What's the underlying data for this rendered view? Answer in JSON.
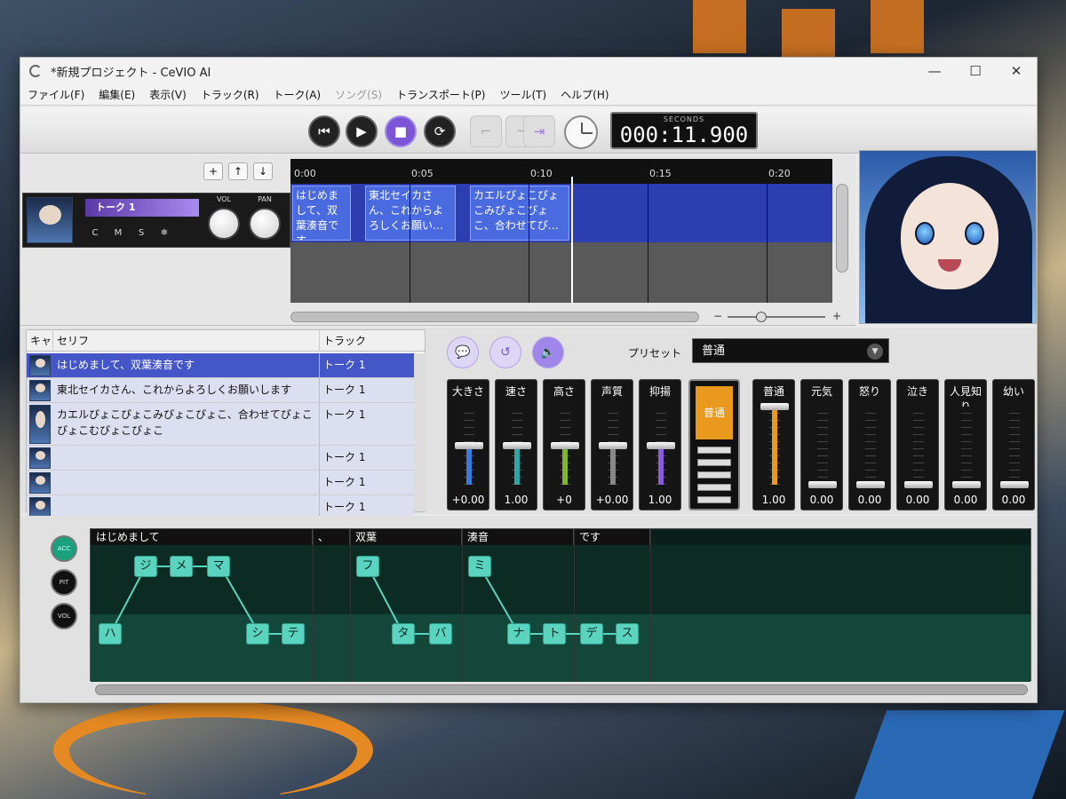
{
  "window": {
    "title": "*新規プロジェクト - CeVIO AI",
    "controls": [
      "—",
      "☐",
      "✕"
    ]
  },
  "menu": [
    {
      "label": "ファイル(F)",
      "enabled": true
    },
    {
      "label": "編集(E)",
      "enabled": true
    },
    {
      "label": "表示(V)",
      "enabled": true
    },
    {
      "label": "トラック(R)",
      "enabled": true
    },
    {
      "label": "トーク(A)",
      "enabled": true
    },
    {
      "label": "ソング(S)",
      "enabled": false
    },
    {
      "label": "トランスポート(P)",
      "enabled": true
    },
    {
      "label": "ツール(T)",
      "enabled": true
    },
    {
      "label": "ヘルプ(H)",
      "enabled": true
    }
  ],
  "transport": {
    "time_label": "SECONDS",
    "time_value": "000:11.900"
  },
  "track_controls": {
    "add": "+",
    "up": "↑",
    "down": "↓"
  },
  "track": {
    "name": "トーク 1",
    "buttons": [
      "C",
      "M",
      "S",
      "❄"
    ],
    "vol_label": "VOL",
    "pan_label": "PAN"
  },
  "timeline": {
    "ticks": [
      "0:00",
      "0:05",
      "0:10",
      "0:15",
      "0:20"
    ],
    "clips": [
      "はじめまして、双葉湊音です",
      "東北セイカさん、これからよろしくお願い…",
      "カエルぴょこぴょこみぴょこぴょこ、合わせてぴ…"
    ]
  },
  "zoom": {
    "minus": "−",
    "plus": "+"
  },
  "table": {
    "headers": [
      "キャ",
      "セリフ",
      "トラック"
    ],
    "rows": [
      {
        "text": "はじめまして、双葉湊音です",
        "track": "トーク 1",
        "selected": true
      },
      {
        "text": "東北セイカさん、これからよろしくお願いします",
        "track": "トーク 1",
        "selected": false
      },
      {
        "text": "カエルぴょこぴょこみぴょこぴょこ、合わせてぴょこぴょこむぴょこぴょこ",
        "track": "トーク 1",
        "selected": false
      },
      {
        "text": "",
        "track": "トーク 1",
        "selected": false
      },
      {
        "text": "",
        "track": "トーク 1",
        "selected": false
      },
      {
        "text": "",
        "track": "トーク 1",
        "selected": false
      }
    ]
  },
  "params": {
    "preset_label": "プリセット",
    "preset_value": "普通",
    "sliders": [
      {
        "name": "大きさ",
        "value": "+0.00",
        "color": "#3b7be0",
        "level": 0.5
      },
      {
        "name": "速さ",
        "value": "1.00",
        "color": "#2aa8a8",
        "level": 0.5
      },
      {
        "name": "高さ",
        "value": "+0",
        "color": "#7fb52a",
        "level": 0.5
      },
      {
        "name": "声質",
        "value": "+0.00",
        "color": "#888888",
        "level": 0.5
      },
      {
        "name": "抑揚",
        "value": "1.00",
        "color": "#8a5be0",
        "level": 0.5
      }
    ],
    "emotion_selector": "普通",
    "emotions": [
      {
        "name": "普通",
        "value": "1.00",
        "level": 1.0
      },
      {
        "name": "元気",
        "value": "0.00",
        "level": 0
      },
      {
        "name": "怒り",
        "value": "0.00",
        "level": 0
      },
      {
        "name": "泣き",
        "value": "0.00",
        "level": 0
      },
      {
        "name": "人見知り",
        "value": "0.00",
        "level": 0
      },
      {
        "name": "幼い",
        "value": "0.00",
        "level": 0
      }
    ]
  },
  "pitch": {
    "side": [
      "ACC",
      "PIT",
      "VOL"
    ],
    "phrases": [
      "はじめまして",
      "、",
      "双葉",
      "湊音",
      "です"
    ],
    "morae": [
      "ハ",
      "ジ",
      "メ",
      "マ",
      "シ",
      "テ",
      "フ",
      "タ",
      "バ",
      "ミ",
      "ナ",
      "ト",
      "デ",
      "ス"
    ]
  }
}
